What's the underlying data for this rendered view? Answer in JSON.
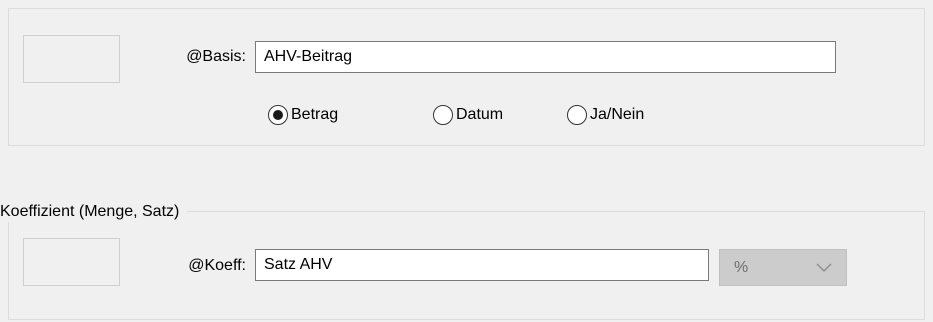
{
  "basis": {
    "label": "@Basis:",
    "input_value": "AHV-Beitrag",
    "radio_options": [
      {
        "label": "Betrag",
        "selected": true
      },
      {
        "label": "Datum",
        "selected": false
      },
      {
        "label": "Ja/Nein",
        "selected": false
      }
    ]
  },
  "koeff": {
    "group_title": "Koeffizient (Menge, Satz)",
    "label": "@Koeff:",
    "input_value": "Satz AHV",
    "unit_select": {
      "value": "%",
      "disabled": true
    }
  },
  "colors": {
    "background": "#f0f0f0",
    "input_border": "#7a7a7a",
    "disabled_select": "#cccccc"
  }
}
